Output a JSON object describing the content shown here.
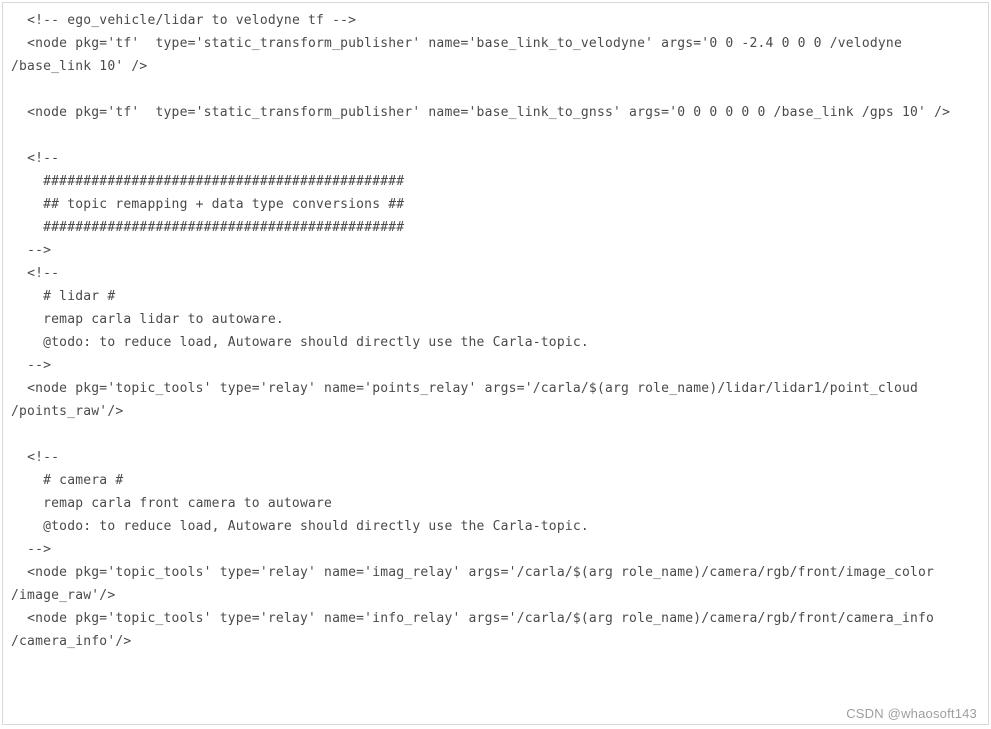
{
  "code": {
    "lines": [
      "  <!-- ego_vehicle/lidar to velodyne tf -->",
      "  <node pkg='tf'  type='static_transform_publisher' name='base_link_to_velodyne' args='0 0 -2.4 0 0 0 /velodyne /base_link 10' />",
      "",
      "  <node pkg='tf'  type='static_transform_publisher' name='base_link_to_gnss' args='0 0 0 0 0 0 /base_link /gps 10' />",
      "",
      "  <!--",
      "    #############################################",
      "    ## topic remapping + data type conversions ##",
      "    #############################################",
      "  -->",
      "  <!--",
      "    # lidar #",
      "    remap carla lidar to autoware.",
      "    @todo: to reduce load, Autoware should directly use the Carla-topic.",
      "  -->",
      "  <node pkg='topic_tools' type='relay' name='points_relay' args='/carla/$(arg role_name)/lidar/lidar1/point_cloud /points_raw'/>",
      "",
      "  <!--",
      "    # camera #",
      "    remap carla front camera to autoware",
      "    @todo: to reduce load, Autoware should directly use the Carla-topic.",
      "  -->",
      "  <node pkg='topic_tools' type='relay' name='imag_relay' args='/carla/$(arg role_name)/camera/rgb/front/image_color /image_raw'/>",
      "  <node pkg='topic_tools' type='relay' name='info_relay' args='/carla/$(arg role_name)/camera/rgb/front/camera_info /camera_info'/>"
    ]
  },
  "watermark": "CSDN @whaosoft143"
}
